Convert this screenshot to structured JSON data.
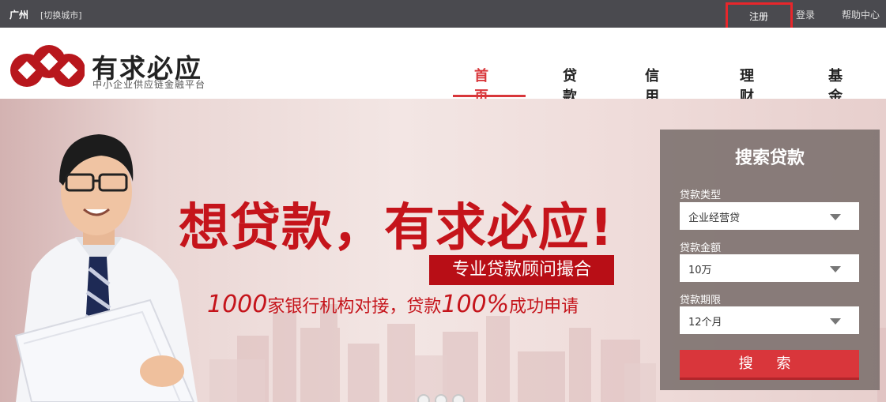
{
  "topbar": {
    "city": "广州",
    "switch_city": "[切换城市]",
    "register": "注册",
    "login": "登录",
    "help": "帮助中心"
  },
  "header": {
    "brand": "有求必应",
    "brand_sub": "中小企业供应链金融平台",
    "nav": [
      "首页",
      "贷款",
      "信用卡",
      "理财",
      "基金"
    ],
    "active_nav": "首页"
  },
  "banner": {
    "headline": "想贷款，有求必应!",
    "badge": "专业贷款顾问撮合",
    "tagline_num1": "1000",
    "tagline_mid": "家银行机构对接，贷款",
    "tagline_num2": "100%",
    "tagline_end": "成功申请",
    "carousel_dots": 3
  },
  "search_panel": {
    "title": "搜索贷款",
    "fields": [
      {
        "label": "贷款类型",
        "value": "企业经营贷"
      },
      {
        "label": "贷款金额",
        "value": "10万"
      },
      {
        "label": "贷款期限",
        "value": "12个月"
      }
    ],
    "button": "搜 索"
  },
  "colors": {
    "accent": "#d8363a",
    "topbar": "#4a4a4f",
    "headline": "#c5141b"
  }
}
